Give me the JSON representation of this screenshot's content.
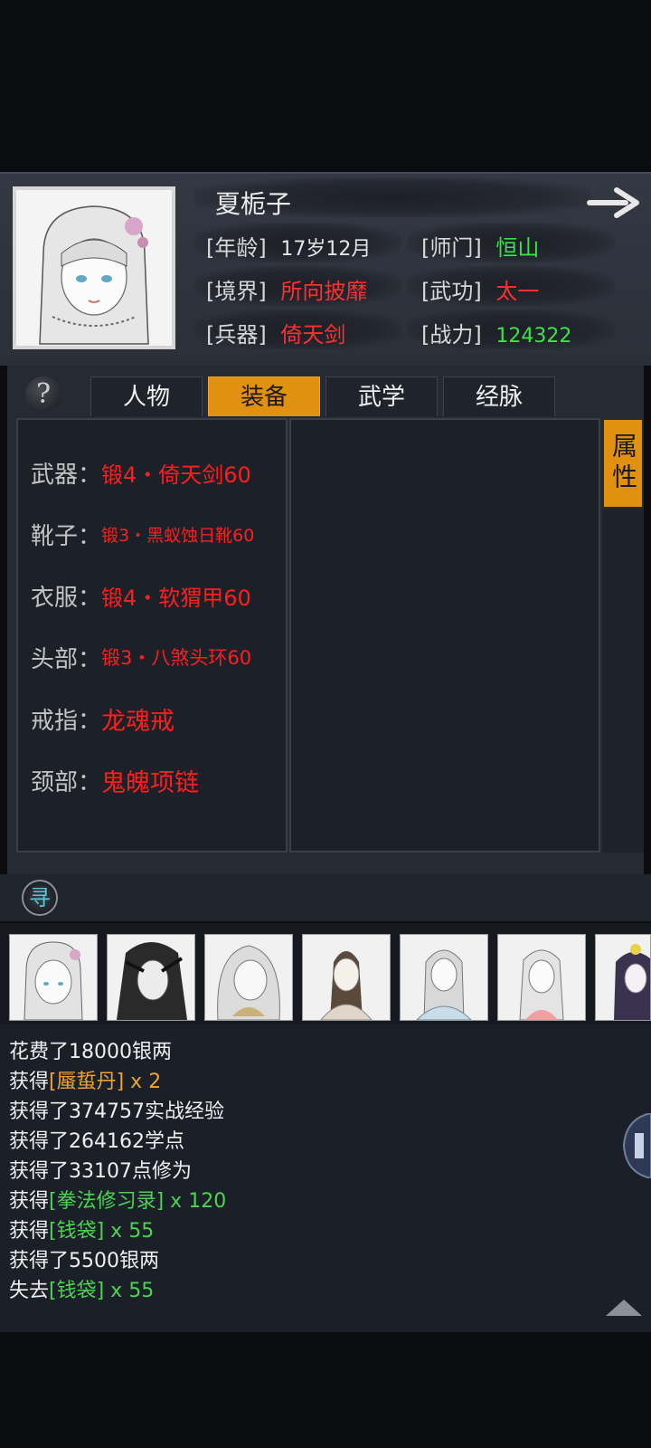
{
  "character": {
    "name": "夏栀子",
    "age_label": "[年龄]",
    "age_value": "17岁12月",
    "sect_label": "[师门]",
    "sect_value": "恒山",
    "realm_label": "[境界]",
    "realm_value": "所向披靡",
    "skill_label": "[武功]",
    "skill_value": "太一",
    "weapon_label": "[兵器]",
    "weapon_value": "倚天剑",
    "power_label": "[战力]",
    "power_value": "124322"
  },
  "help_icon": "?",
  "tabs": [
    {
      "label": "人物",
      "active": false
    },
    {
      "label": "装备",
      "active": true
    },
    {
      "label": "武学",
      "active": false
    },
    {
      "label": "经脉",
      "active": false
    }
  ],
  "attr_button": "属性",
  "equipment": [
    {
      "slot": "武器：",
      "item": "锻4・倚天剑60"
    },
    {
      "slot": "靴子：",
      "item": "锻3・黑蚁蚀日靴60"
    },
    {
      "slot": "衣服：",
      "item": "锻4・软猬甲60"
    },
    {
      "slot": "头部：",
      "item": "锻3・八煞头环60"
    },
    {
      "slot": "戒指：",
      "item": "龙魂戒"
    },
    {
      "slot": "颈部：",
      "item": "鬼魄项链"
    }
  ],
  "search_icon_glyph": "寻",
  "log": [
    {
      "pre": "花费了18000银两",
      "item": "",
      "post": "",
      "color": ""
    },
    {
      "pre": "获得",
      "item": "[蜃蜇丹]",
      "post": " x 2",
      "color": "orange"
    },
    {
      "pre": "获得了374757实战经验",
      "item": "",
      "post": "",
      "color": ""
    },
    {
      "pre": "获得了264162学点",
      "item": "",
      "post": "",
      "color": ""
    },
    {
      "pre": "获得了33107点修为",
      "item": "",
      "post": "",
      "color": ""
    },
    {
      "pre": "获得",
      "item": "[拳法修习录]",
      "post": " x 120",
      "color": "green"
    },
    {
      "pre": "获得",
      "item": "[钱袋]",
      "post": " x 55",
      "color": "green"
    },
    {
      "pre": "获得了5500银两",
      "item": "",
      "post": "",
      "color": ""
    },
    {
      "pre": "失去",
      "item": "[钱袋]",
      "post": " x 55",
      "color": "green"
    }
  ],
  "icons": [
    "arrow-right-icon",
    "help-icon",
    "search-icon",
    "scroll-up-icon"
  ]
}
